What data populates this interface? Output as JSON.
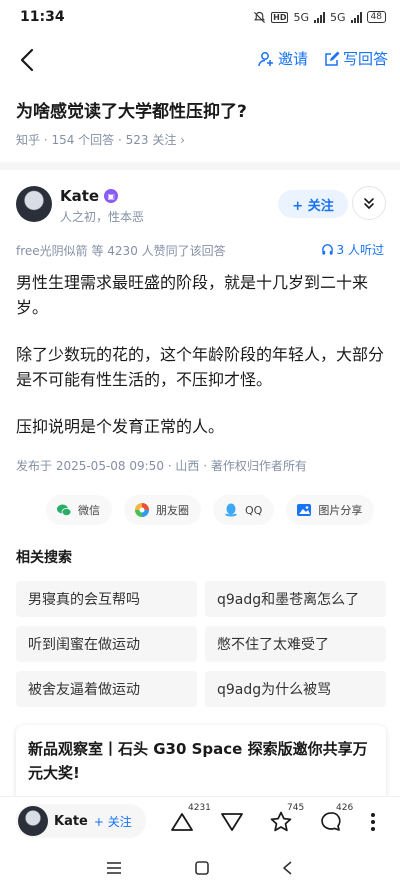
{
  "status_bar": {
    "time": "11:34",
    "network_hd": "HD",
    "network_1": "5G",
    "network_2": "5G",
    "battery": "48"
  },
  "nav": {
    "invite_label": "邀请",
    "write_answer_label": "写回答"
  },
  "question": {
    "title": "为啥感觉读了大学都性压抑了?",
    "meta": "知乎 · 154 个回答 · 523 关注 ›"
  },
  "author": {
    "name": "Kate",
    "bio": "人之初，性本恶",
    "follow_label": "+ 关注"
  },
  "answer": {
    "upvote_line": "free光阴似箭 等 4230 人赞同了该回答",
    "listen_line": "3 人听过",
    "paragraphs": [
      "男性生理需求最旺盛的阶段，就是十几岁到二十来岁。",
      "除了少数玩的花的，这个年龄阶段的年轻人，大部分是不可能有性生活的，不压抑才怪。",
      "压抑说明是个发育正常的人。"
    ],
    "publish_info": "发布于 2025-05-08 09:50 · 山西 · 著作权归作者所有"
  },
  "share": {
    "wechat": "微信",
    "moments": "朋友圈",
    "qq": "QQ",
    "image_share": "图片分享"
  },
  "related": {
    "title": "相关搜索",
    "items": [
      "男寝真的会互帮吗",
      "q9adg和墨苍离怎么了",
      "听到闺蜜在做运动",
      "憋不住了太难受了",
      "被舍友逼着做运动",
      "q9adg为什么被骂"
    ]
  },
  "ad": {
    "text": "新品观察室丨石头 G30 Space 探索版邀你共享万元大奖!"
  },
  "bottom_bar": {
    "author_name": "Kate",
    "follow_label": "+ 关注",
    "upvote_count": "4231",
    "comment_count": "745",
    "favorite_count": "426"
  },
  "colors": {
    "accent": "#1772f6",
    "meta_gray": "#8590a6",
    "badge_purple": "#8a5cf6"
  }
}
